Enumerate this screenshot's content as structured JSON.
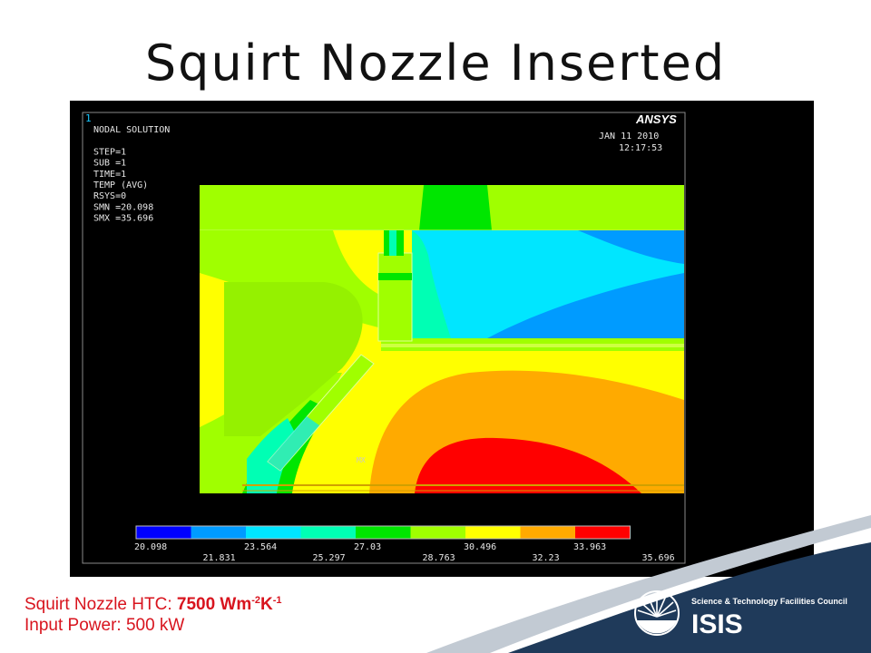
{
  "slide": {
    "title": "Squirt Nozzle Inserted"
  },
  "fea": {
    "window_number": "1",
    "info_lines": [
      "NODAL SOLUTION",
      "",
      "STEP=1",
      "SUB =1",
      "TIME=1",
      "TEMP     (AVG)",
      "RSYS=0",
      "SMN =20.098",
      "SMX =35.696"
    ],
    "brand": "ANSYS",
    "date": "JAN 11 2010",
    "time": "12:17:53",
    "mx_marker": "MX",
    "legend": {
      "colors": [
        "#0000ff",
        "#009bff",
        "#00e6ff",
        "#00ffb4",
        "#00e600",
        "#a0ff00",
        "#ffff00",
        "#ffaa00",
        "#ff0000"
      ],
      "labels_top": [
        "20.098",
        "23.564",
        "27.03",
        "30.496",
        "33.963"
      ],
      "labels_bottom": [
        "21.831",
        "25.297",
        "28.763",
        "32.23",
        "35.696"
      ]
    }
  },
  "caption": {
    "line1_prefix": "Squirt Nozzle HTC: ",
    "line1_value": "7500 Wm",
    "line1_sup1": "-2",
    "line1_unit2": "K",
    "line1_sup2": "-1",
    "line2": "Input Power: 500 kW"
  },
  "footer": {
    "org_line": "Science & Technology Facilities Council",
    "logo_text": "ISIS"
  },
  "colors": {
    "caption": "#d8141e",
    "swoosh": "#1f3a5a",
    "swoosh_light": "#9aa7b6"
  }
}
